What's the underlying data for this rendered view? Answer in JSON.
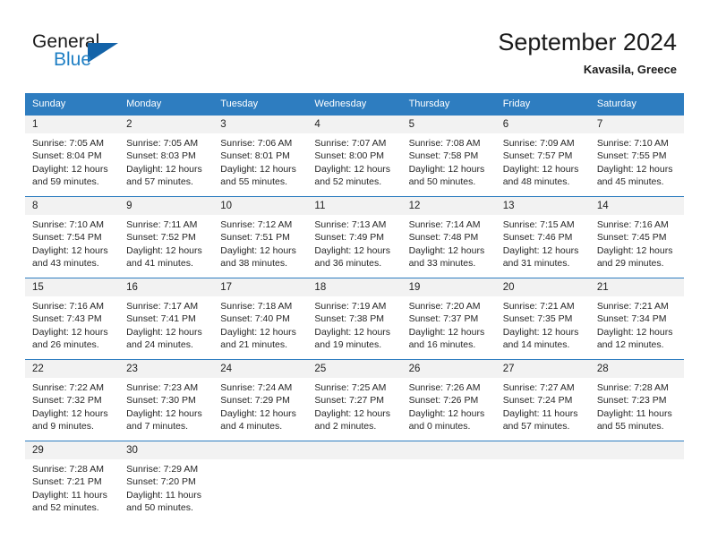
{
  "brand": {
    "name_part1": "General",
    "name_part2": "Blue"
  },
  "header": {
    "month_title": "September 2024",
    "location": "Kavasila, Greece"
  },
  "colors": {
    "header_blue": "#2e7dc0",
    "logo_blue": "#1f7fc4",
    "daynum_background": "#f2f2f2"
  },
  "labels": {
    "sunrise_prefix": "Sunrise:",
    "sunset_prefix": "Sunset:",
    "daylight_prefix": "Daylight:"
  },
  "weekday_headers": [
    "Sunday",
    "Monday",
    "Tuesday",
    "Wednesday",
    "Thursday",
    "Friday",
    "Saturday"
  ],
  "weeks": [
    [
      {
        "day": "1",
        "sunrise": "Sunrise: 7:05 AM",
        "sunset": "Sunset: 8:04 PM",
        "daylight_line1": "Daylight: 12 hours",
        "daylight_line2": "and 59 minutes."
      },
      {
        "day": "2",
        "sunrise": "Sunrise: 7:05 AM",
        "sunset": "Sunset: 8:03 PM",
        "daylight_line1": "Daylight: 12 hours",
        "daylight_line2": "and 57 minutes."
      },
      {
        "day": "3",
        "sunrise": "Sunrise: 7:06 AM",
        "sunset": "Sunset: 8:01 PM",
        "daylight_line1": "Daylight: 12 hours",
        "daylight_line2": "and 55 minutes."
      },
      {
        "day": "4",
        "sunrise": "Sunrise: 7:07 AM",
        "sunset": "Sunset: 8:00 PM",
        "daylight_line1": "Daylight: 12 hours",
        "daylight_line2": "and 52 minutes."
      },
      {
        "day": "5",
        "sunrise": "Sunrise: 7:08 AM",
        "sunset": "Sunset: 7:58 PM",
        "daylight_line1": "Daylight: 12 hours",
        "daylight_line2": "and 50 minutes."
      },
      {
        "day": "6",
        "sunrise": "Sunrise: 7:09 AM",
        "sunset": "Sunset: 7:57 PM",
        "daylight_line1": "Daylight: 12 hours",
        "daylight_line2": "and 48 minutes."
      },
      {
        "day": "7",
        "sunrise": "Sunrise: 7:10 AM",
        "sunset": "Sunset: 7:55 PM",
        "daylight_line1": "Daylight: 12 hours",
        "daylight_line2": "and 45 minutes."
      }
    ],
    [
      {
        "day": "8",
        "sunrise": "Sunrise: 7:10 AM",
        "sunset": "Sunset: 7:54 PM",
        "daylight_line1": "Daylight: 12 hours",
        "daylight_line2": "and 43 minutes."
      },
      {
        "day": "9",
        "sunrise": "Sunrise: 7:11 AM",
        "sunset": "Sunset: 7:52 PM",
        "daylight_line1": "Daylight: 12 hours",
        "daylight_line2": "and 41 minutes."
      },
      {
        "day": "10",
        "sunrise": "Sunrise: 7:12 AM",
        "sunset": "Sunset: 7:51 PM",
        "daylight_line1": "Daylight: 12 hours",
        "daylight_line2": "and 38 minutes."
      },
      {
        "day": "11",
        "sunrise": "Sunrise: 7:13 AM",
        "sunset": "Sunset: 7:49 PM",
        "daylight_line1": "Daylight: 12 hours",
        "daylight_line2": "and 36 minutes."
      },
      {
        "day": "12",
        "sunrise": "Sunrise: 7:14 AM",
        "sunset": "Sunset: 7:48 PM",
        "daylight_line1": "Daylight: 12 hours",
        "daylight_line2": "and 33 minutes."
      },
      {
        "day": "13",
        "sunrise": "Sunrise: 7:15 AM",
        "sunset": "Sunset: 7:46 PM",
        "daylight_line1": "Daylight: 12 hours",
        "daylight_line2": "and 31 minutes."
      },
      {
        "day": "14",
        "sunrise": "Sunrise: 7:16 AM",
        "sunset": "Sunset: 7:45 PM",
        "daylight_line1": "Daylight: 12 hours",
        "daylight_line2": "and 29 minutes."
      }
    ],
    [
      {
        "day": "15",
        "sunrise": "Sunrise: 7:16 AM",
        "sunset": "Sunset: 7:43 PM",
        "daylight_line1": "Daylight: 12 hours",
        "daylight_line2": "and 26 minutes."
      },
      {
        "day": "16",
        "sunrise": "Sunrise: 7:17 AM",
        "sunset": "Sunset: 7:41 PM",
        "daylight_line1": "Daylight: 12 hours",
        "daylight_line2": "and 24 minutes."
      },
      {
        "day": "17",
        "sunrise": "Sunrise: 7:18 AM",
        "sunset": "Sunset: 7:40 PM",
        "daylight_line1": "Daylight: 12 hours",
        "daylight_line2": "and 21 minutes."
      },
      {
        "day": "18",
        "sunrise": "Sunrise: 7:19 AM",
        "sunset": "Sunset: 7:38 PM",
        "daylight_line1": "Daylight: 12 hours",
        "daylight_line2": "and 19 minutes."
      },
      {
        "day": "19",
        "sunrise": "Sunrise: 7:20 AM",
        "sunset": "Sunset: 7:37 PM",
        "daylight_line1": "Daylight: 12 hours",
        "daylight_line2": "and 16 minutes."
      },
      {
        "day": "20",
        "sunrise": "Sunrise: 7:21 AM",
        "sunset": "Sunset: 7:35 PM",
        "daylight_line1": "Daylight: 12 hours",
        "daylight_line2": "and 14 minutes."
      },
      {
        "day": "21",
        "sunrise": "Sunrise: 7:21 AM",
        "sunset": "Sunset: 7:34 PM",
        "daylight_line1": "Daylight: 12 hours",
        "daylight_line2": "and 12 minutes."
      }
    ],
    [
      {
        "day": "22",
        "sunrise": "Sunrise: 7:22 AM",
        "sunset": "Sunset: 7:32 PM",
        "daylight_line1": "Daylight: 12 hours",
        "daylight_line2": "and 9 minutes."
      },
      {
        "day": "23",
        "sunrise": "Sunrise: 7:23 AM",
        "sunset": "Sunset: 7:30 PM",
        "daylight_line1": "Daylight: 12 hours",
        "daylight_line2": "and 7 minutes."
      },
      {
        "day": "24",
        "sunrise": "Sunrise: 7:24 AM",
        "sunset": "Sunset: 7:29 PM",
        "daylight_line1": "Daylight: 12 hours",
        "daylight_line2": "and 4 minutes."
      },
      {
        "day": "25",
        "sunrise": "Sunrise: 7:25 AM",
        "sunset": "Sunset: 7:27 PM",
        "daylight_line1": "Daylight: 12 hours",
        "daylight_line2": "and 2 minutes."
      },
      {
        "day": "26",
        "sunrise": "Sunrise: 7:26 AM",
        "sunset": "Sunset: 7:26 PM",
        "daylight_line1": "Daylight: 12 hours",
        "daylight_line2": "and 0 minutes."
      },
      {
        "day": "27",
        "sunrise": "Sunrise: 7:27 AM",
        "sunset": "Sunset: 7:24 PM",
        "daylight_line1": "Daylight: 11 hours",
        "daylight_line2": "and 57 minutes."
      },
      {
        "day": "28",
        "sunrise": "Sunrise: 7:28 AM",
        "sunset": "Sunset: 7:23 PM",
        "daylight_line1": "Daylight: 11 hours",
        "daylight_line2": "and 55 minutes."
      }
    ],
    [
      {
        "day": "29",
        "sunrise": "Sunrise: 7:28 AM",
        "sunset": "Sunset: 7:21 PM",
        "daylight_line1": "Daylight: 11 hours",
        "daylight_line2": "and 52 minutes."
      },
      {
        "day": "30",
        "sunrise": "Sunrise: 7:29 AM",
        "sunset": "Sunset: 7:20 PM",
        "daylight_line1": "Daylight: 11 hours",
        "daylight_line2": "and 50 minutes."
      },
      {
        "day": "",
        "sunrise": "",
        "sunset": "",
        "daylight_line1": "",
        "daylight_line2": ""
      },
      {
        "day": "",
        "sunrise": "",
        "sunset": "",
        "daylight_line1": "",
        "daylight_line2": ""
      },
      {
        "day": "",
        "sunrise": "",
        "sunset": "",
        "daylight_line1": "",
        "daylight_line2": ""
      },
      {
        "day": "",
        "sunrise": "",
        "sunset": "",
        "daylight_line1": "",
        "daylight_line2": ""
      },
      {
        "day": "",
        "sunrise": "",
        "sunset": "",
        "daylight_line1": "",
        "daylight_line2": ""
      }
    ]
  ]
}
